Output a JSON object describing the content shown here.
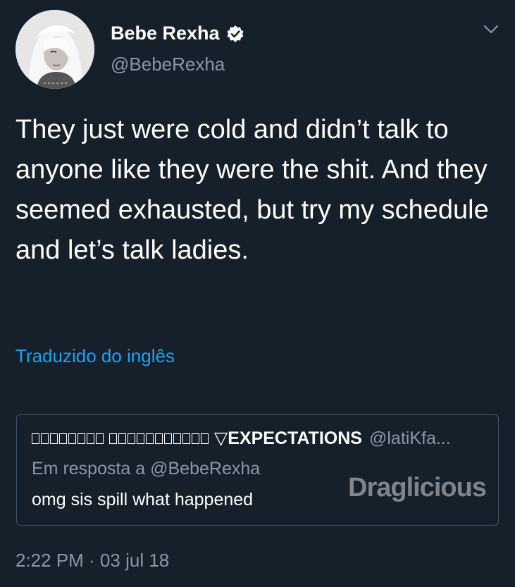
{
  "tweet": {
    "author": {
      "display_name": "Bebe Rexha",
      "handle": "@BebeRexha",
      "verified": true,
      "avatar": "profile-photo"
    },
    "text": "They just were cold and didn’t talk to anyone like they were the shit. And they seemed exhausted, but try my schedule and let’s talk ladies.",
    "translate_label": "Traduzido do inglês",
    "timestamp": "2:22 PM · 03 jul 18",
    "menu_icon": "chevron-down-icon"
  },
  "quoted": {
    "name_suffix": "▽EXPECTATIONS",
    "handle": "@latiKfa...",
    "reply_to": "Em resposta a @BebeRexha",
    "text": "omg sis spill what happened"
  },
  "watermark": {
    "text": "Draglicious"
  },
  "colors": {
    "background": "#15202b",
    "text": "#ffffff",
    "muted": "#8899a6",
    "link": "#1da1f2",
    "border": "#3d5466"
  }
}
